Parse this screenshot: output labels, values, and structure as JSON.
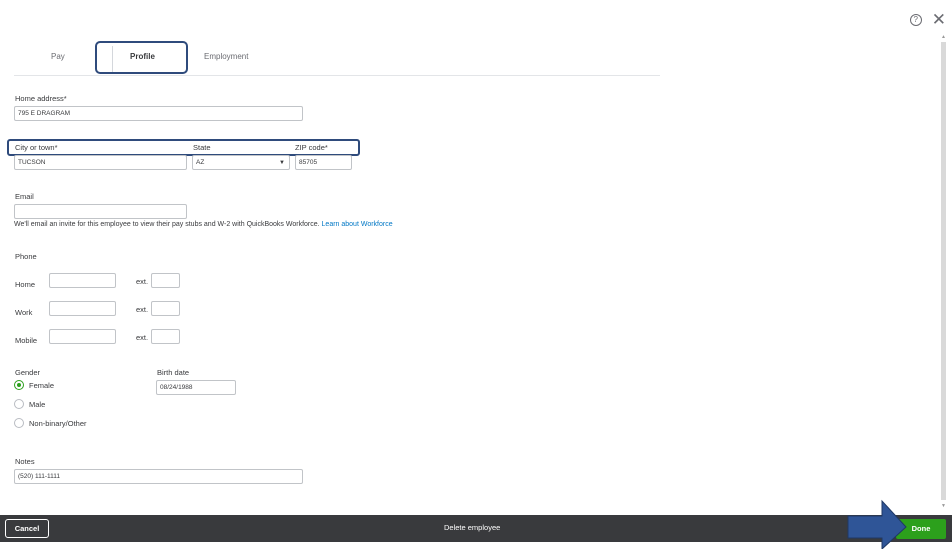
{
  "header": {
    "help_icon": "question-circle-icon",
    "close_icon": "close-icon"
  },
  "tabs": [
    {
      "label": "Pay"
    },
    {
      "label": "Profile"
    },
    {
      "label": "Employment"
    }
  ],
  "form": {
    "home_address": {
      "label": "Home address*",
      "value": "795 E DRAGRAM"
    },
    "city": {
      "label": "City or town*",
      "value": "TUCSON"
    },
    "state": {
      "label": "State",
      "value": "AZ"
    },
    "zip": {
      "label": "ZIP code*",
      "value": "85705"
    },
    "email": {
      "label": "Email",
      "value": ""
    },
    "email_hint": "We'll email an invite for this employee to view their pay stubs and W-2 with QuickBooks Workforce.",
    "email_hint_link": "Learn about Workforce",
    "phone": {
      "label": "Phone",
      "rows": [
        {
          "label": "Home",
          "ext_label": "ext."
        },
        {
          "label": "Work",
          "ext_label": "ext."
        },
        {
          "label": "Mobile",
          "ext_label": "ext."
        }
      ]
    },
    "gender": {
      "label": "Gender",
      "options": [
        {
          "label": "Female"
        },
        {
          "label": "Male"
        },
        {
          "label": "Non-binary/Other"
        }
      ],
      "selected": "Female"
    },
    "birth_date": {
      "label": "Birth date",
      "value": "08/24/1988"
    },
    "notes": {
      "label": "Notes",
      "value": "(520) 111-1111"
    }
  },
  "footer": {
    "cancel_label": "Cancel",
    "delete_label": "Delete employee",
    "done_label": "Done"
  },
  "colors": {
    "accent_green": "#2ca01c",
    "highlight_blue": "#2f4b7c",
    "footer_bg": "#393a3d"
  }
}
